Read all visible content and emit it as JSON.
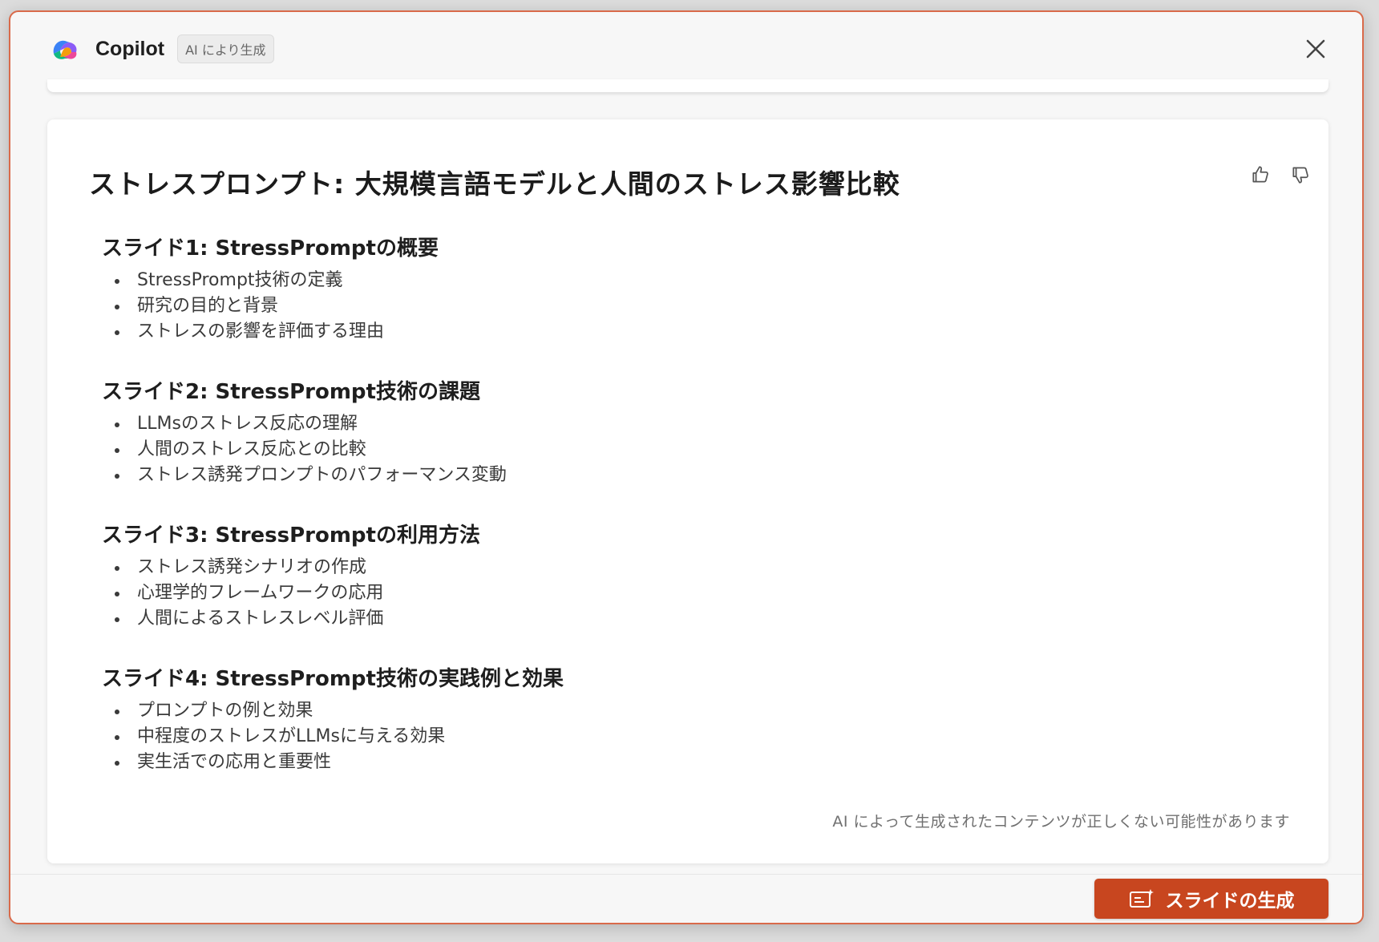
{
  "header": {
    "app_title": "Copilot",
    "ai_badge": "AI により生成"
  },
  "document": {
    "title": "ストレスプロンプト: 大規模言語モデルと人間のストレス影響比較",
    "slides": [
      {
        "heading": "スライド1: StressPromptの概要",
        "bullets": [
          "StressPrompt技術の定義",
          "研究の目的と背景",
          "ストレスの影響を評価する理由"
        ]
      },
      {
        "heading": "スライド2: StressPrompt技術の課題",
        "bullets": [
          "LLMsのストレス反応の理解",
          "人間のストレス反応との比較",
          "ストレス誘発プロンプトのパフォーマンス変動"
        ]
      },
      {
        "heading": "スライド3: StressPromptの利用方法",
        "bullets": [
          "ストレス誘発シナリオの作成",
          "心理学的フレームワークの応用",
          "人間によるストレスレベル評価"
        ]
      },
      {
        "heading": "スライド4: StressPrompt技術の実践例と効果",
        "bullets": [
          "プロンプトの例と効果",
          "中程度のストレスがLLMsに与える効果",
          "実生活での応用と重要性"
        ]
      }
    ],
    "disclaimer": "AI によって生成されたコンテンツが正しくない可能性があります"
  },
  "footer": {
    "generate_label": "スライドの生成"
  },
  "colors": {
    "accent": "#c8461f",
    "dialog_border": "#d96a4a"
  },
  "icons": {
    "logo": "copilot-logo",
    "close": "close-icon",
    "like": "thumbs-up-icon",
    "dislike": "thumbs-down-icon",
    "generate": "slide-sparkle-icon"
  }
}
